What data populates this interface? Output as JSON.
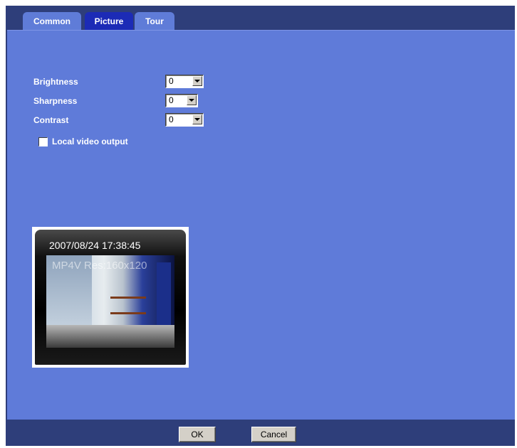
{
  "tabs": [
    {
      "label": "Common"
    },
    {
      "label": "Picture",
      "active": true
    },
    {
      "label": "Tour"
    }
  ],
  "settings": {
    "brightness": {
      "label": "Brightness",
      "value": "0"
    },
    "sharpness": {
      "label": "Sharpness",
      "value": "0"
    },
    "contrast": {
      "label": "Contrast",
      "value": "0"
    }
  },
  "local_video_output": {
    "label": "Local video output",
    "checked": false
  },
  "preview": {
    "timestamp": "2007/08/24 17:38:45",
    "overlay": "MP4V Res:160x120"
  },
  "footer": {
    "ok_label": "OK",
    "cancel_label": "Cancel"
  },
  "colors": {
    "frame": "#2e3e7a",
    "panel": "#5f7bd9",
    "active_tab": "#1c2bb6"
  }
}
